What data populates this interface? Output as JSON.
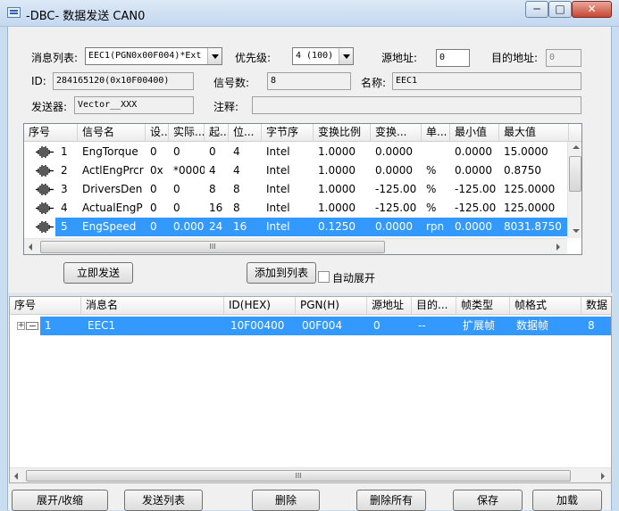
{
  "window": {
    "title": "-DBC- 数据发送 CAN0",
    "minimize": "─",
    "maximize": "□",
    "close": "✕"
  },
  "form": {
    "msg_list_label": "消息列表:",
    "msg_list_value": "EEC1(PGN0x00F004)*Ext",
    "priority_label": "优先级:",
    "priority_value": "4 (100)",
    "source_addr_label": "源地址:",
    "source_addr_value": "0",
    "dest_addr_label": "目的地址:",
    "dest_addr_value": "0",
    "id_label": "ID:",
    "id_value": "284165120(0x10F00400)",
    "signal_count_label": "信号数:",
    "signal_count_value": "8",
    "name_label": "名称:",
    "name_value": "EEC1",
    "sender_label": "发送器:",
    "sender_value": "Vector__XXX",
    "comment_label": "注释:",
    "comment_value": ""
  },
  "signals": {
    "columns": [
      "序号",
      "信号名",
      "设...",
      "实际...",
      "起...",
      "位...",
      "字节序",
      "变换比例",
      "变换...",
      "单...",
      "最小值",
      "最大值"
    ],
    "rows": [
      [
        "1",
        "EngTorque",
        "0",
        "0",
        "0",
        "4",
        "Intel",
        "1.0000",
        "0.0000",
        "",
        "0.0000",
        "15.0000"
      ],
      [
        "2",
        "ActlEngPrcr",
        "0x",
        "*0000",
        "4",
        "4",
        "Intel",
        "1.0000",
        "0.0000",
        "%",
        "0.0000",
        "0.8750"
      ],
      [
        "3",
        "DriversDen",
        "0",
        "0",
        "8",
        "8",
        "Intel",
        "1.0000",
        "-125.00",
        "%",
        "-125.00",
        "125.0000"
      ],
      [
        "4",
        "ActualEngP",
        "0",
        "0",
        "16",
        "8",
        "Intel",
        "1.0000",
        "-125.00",
        "%",
        "-125.00",
        "125.0000"
      ],
      [
        "5",
        "EngSpeed",
        "0",
        "0.000(",
        "24",
        "16",
        "Intel",
        "0.1250",
        "0.0000",
        "rpn",
        "0.0000",
        "8031.8750"
      ]
    ],
    "selected_row": 5,
    "hscroll_grip": "III"
  },
  "actions": {
    "send_now": "立即发送",
    "add_to_list": "添加到列表",
    "auto_expand": "自动展开"
  },
  "send_list": {
    "columns": [
      "序号",
      "消息名",
      "ID(HEX)",
      "PGN(H)",
      "源地址",
      "目的...",
      "帧类型",
      "帧格式",
      "数据"
    ],
    "rows": [
      [
        "1",
        "EEC1",
        "10F00400",
        "00F004",
        "0",
        "--",
        "扩展帧",
        "数据帧",
        "8"
      ]
    ],
    "tree_expander": "+",
    "hscroll_grip": "III"
  },
  "bottom_buttons": {
    "expand_collapse": "展开/收缩",
    "send_list": "发送列表",
    "delete": "删除",
    "delete_all": "删除所有",
    "save": "保存",
    "load": "加载"
  },
  "colors": {
    "selection": "#3399ff",
    "titlebar": "#c4d8ee"
  }
}
